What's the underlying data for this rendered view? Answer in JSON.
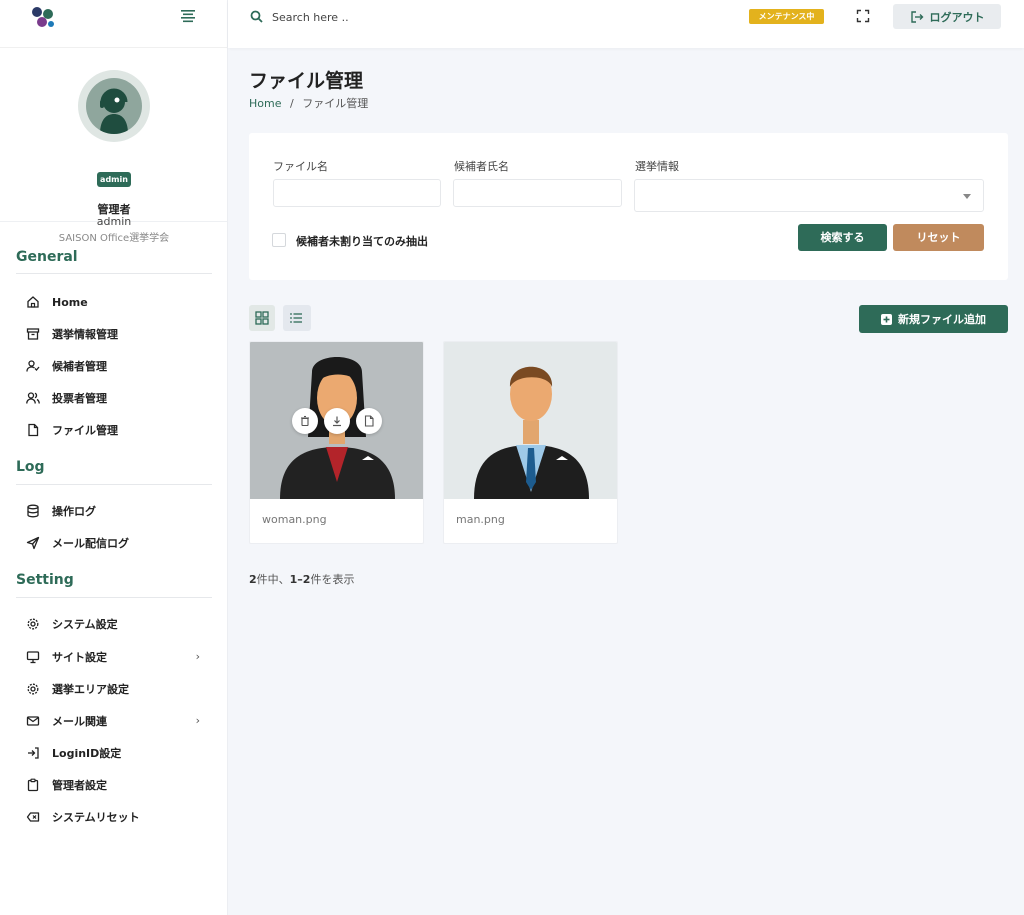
{
  "header": {
    "search_placeholder": "Search here ..",
    "maintenance_badge": "メンテナンス中",
    "logout_label": "ログアウト"
  },
  "profile": {
    "badge": "admin",
    "role": "管理者",
    "username": "admin",
    "organization": "SAISON Office選挙学会"
  },
  "sidebar": {
    "general_title": "General",
    "general_items": [
      {
        "label": "Home",
        "icon": "home-icon"
      },
      {
        "label": "選挙情報管理",
        "icon": "archive-icon"
      },
      {
        "label": "候補者管理",
        "icon": "user-check-icon"
      },
      {
        "label": "投票者管理",
        "icon": "users-icon"
      },
      {
        "label": "ファイル管理",
        "icon": "file-icon"
      }
    ],
    "log_title": "Log",
    "log_items": [
      {
        "label": "操作ログ",
        "icon": "database-icon"
      },
      {
        "label": "メール配信ログ",
        "icon": "send-icon"
      }
    ],
    "setting_title": "Setting",
    "setting_items": [
      {
        "label": "システム設定",
        "icon": "gear-icon"
      },
      {
        "label": "サイト設定",
        "icon": "monitor-icon"
      },
      {
        "label": "選挙エリア設定",
        "icon": "gear-icon"
      },
      {
        "label": "メール関連",
        "icon": "mail-icon"
      },
      {
        "label": "LoginID設定",
        "icon": "login-icon"
      },
      {
        "label": "管理者設定",
        "icon": "clipboard-icon"
      },
      {
        "label": "システムリセット",
        "icon": "backspace-icon"
      }
    ]
  },
  "main": {
    "title": "ファイル管理",
    "breadcrumb_home": "Home",
    "breadcrumb_sep": "/",
    "breadcrumb_current": "ファイル管理"
  },
  "filters": {
    "file_name_label": "ファイル名",
    "file_name_value": "",
    "candidate_label": "候補者氏名",
    "candidate_value": "",
    "election_label": "選挙情報",
    "election_value": "",
    "unassigned_label": "候補者未割り当てのみ抽出",
    "search_button": "検索する",
    "reset_button": "リセット"
  },
  "actions": {
    "add_file_button": "新規ファイル追加"
  },
  "files": [
    {
      "name": "woman.png"
    },
    {
      "name": "man.png"
    }
  ],
  "pagination": {
    "total": "2",
    "total_suffix": "件中、",
    "range": "1–2",
    "range_suffix": "件を表示"
  },
  "colors": {
    "primary": "#2e6b58",
    "reset": "#c08a5d",
    "maintenance": "#e3b21d",
    "background": "#f4f6fa"
  }
}
